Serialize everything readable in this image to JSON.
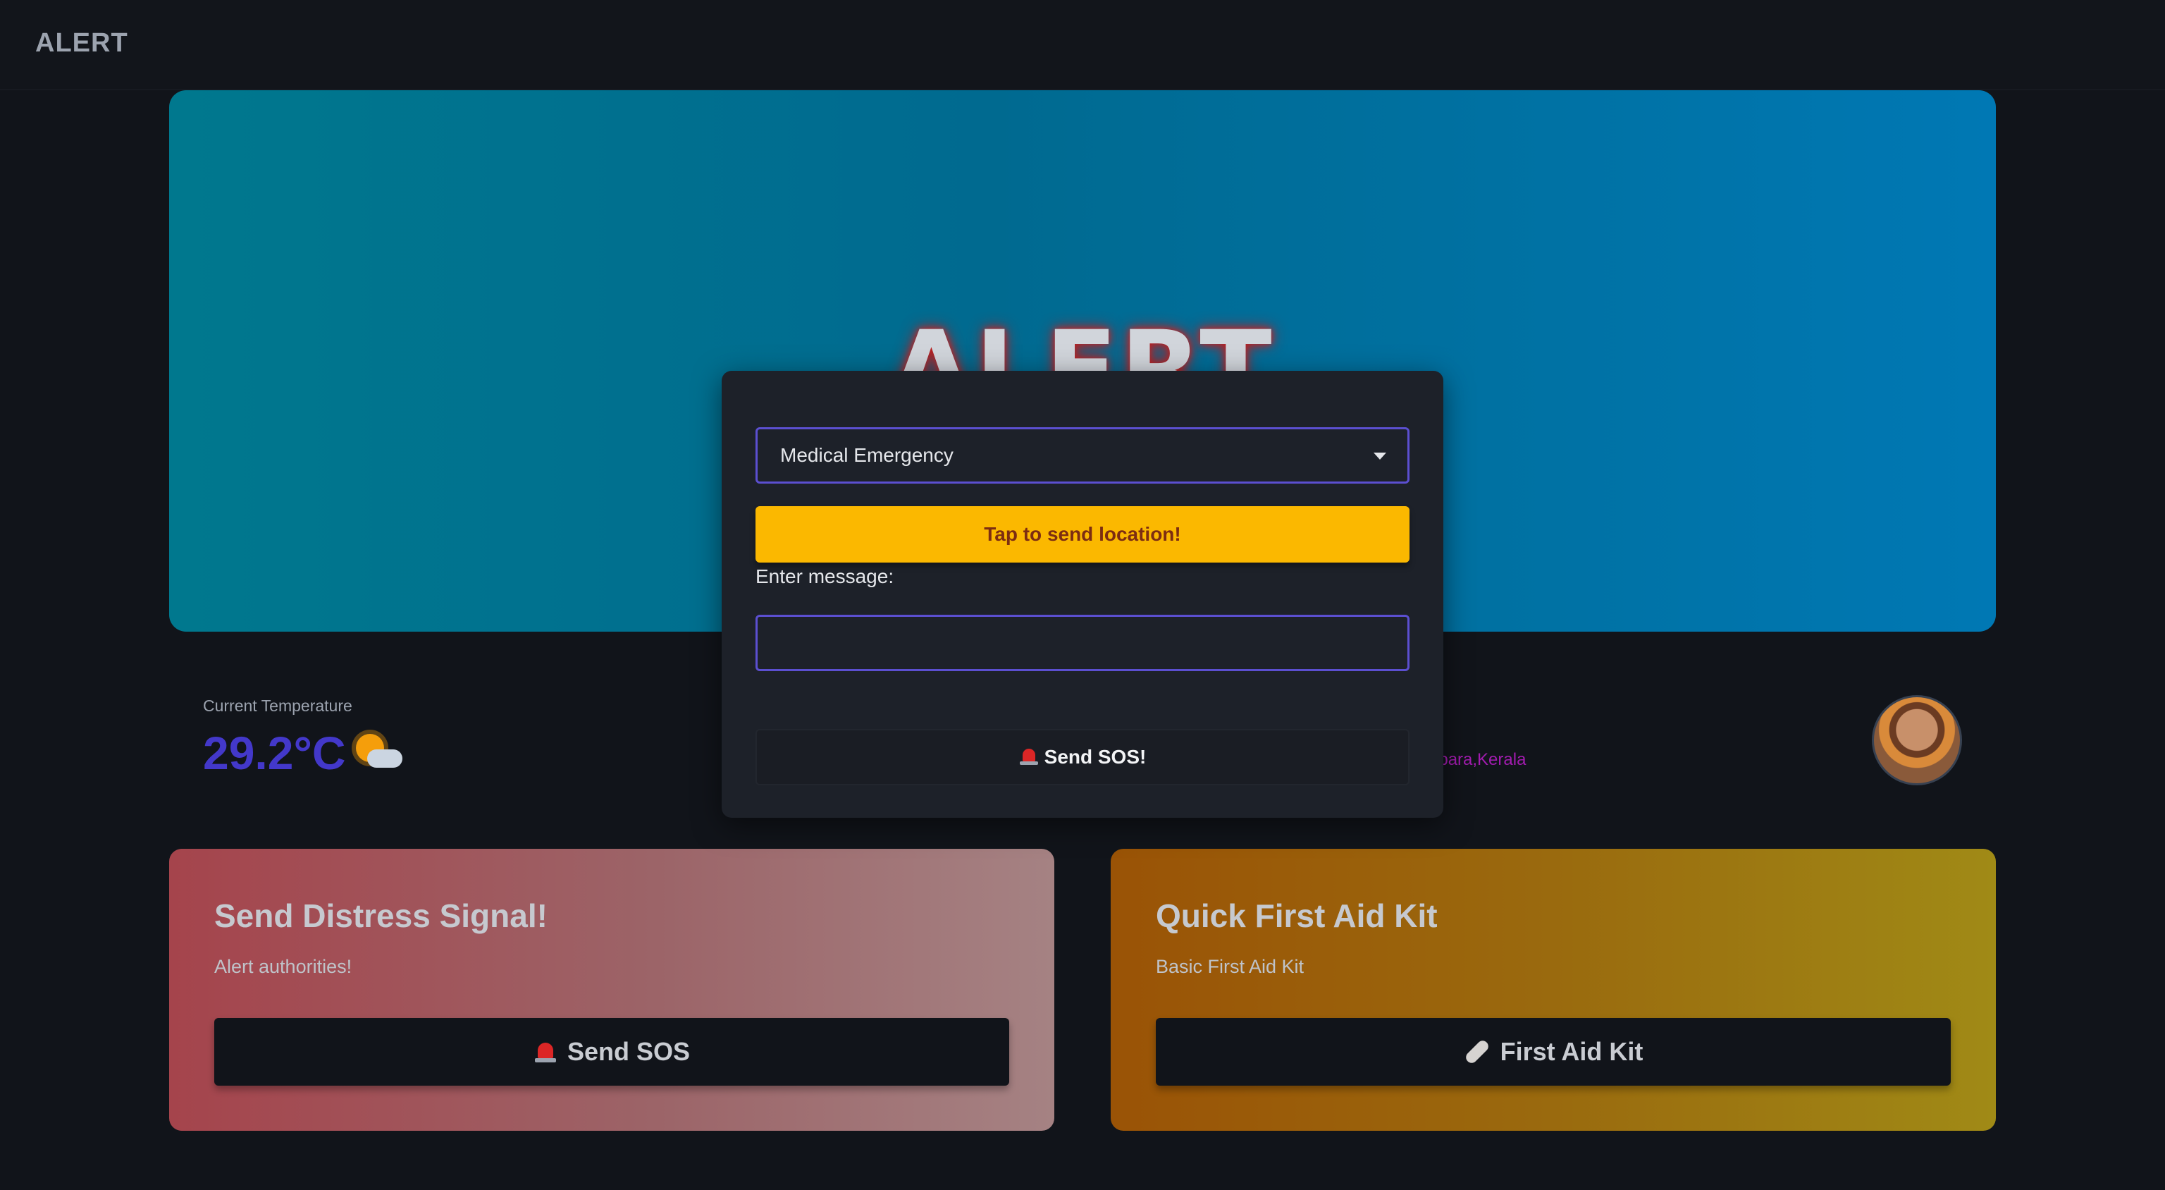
{
  "navbar": {
    "brand": "ALERT"
  },
  "hero": {
    "title": "ALERT"
  },
  "weather": {
    "label": "Current Temperature",
    "value": "29.2°C",
    "icon": "sun-behind-cloud-icon"
  },
  "location": {
    "text": "opara,Kerala"
  },
  "cards": [
    {
      "title": "Send Distress Signal!",
      "subtitle": "Alert authorities!",
      "button_label": "Send SOS",
      "icon": "siren-icon"
    },
    {
      "title": "Quick First Aid Kit",
      "subtitle": "Basic First Aid Kit",
      "button_label": "First Aid Kit",
      "icon": "bandage-icon"
    }
  ],
  "modal": {
    "emergency_type": "Medical Emergency",
    "location_button": "Tap to send location!",
    "message_label": "Enter message:",
    "message_value": "",
    "send_button": "Send SOS!"
  },
  "colors": {
    "accent_border": "#5b4fd0",
    "location_button": "#fbb800",
    "temperature": "#4338ca"
  }
}
